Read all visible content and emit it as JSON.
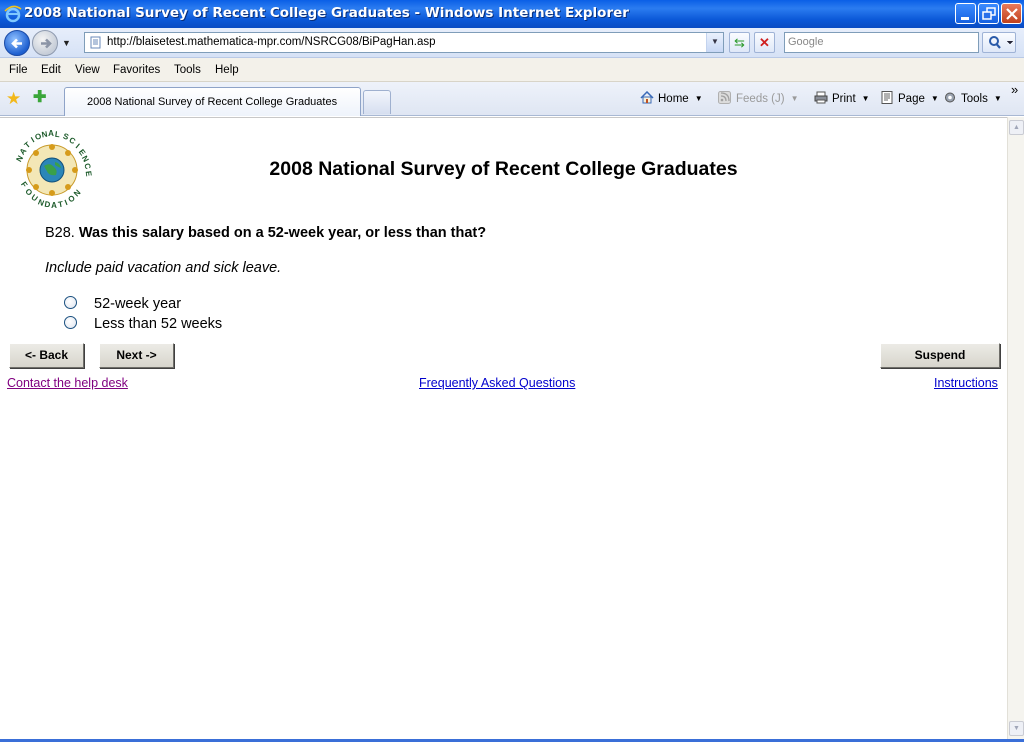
{
  "window": {
    "title": "2008 National Survey of Recent College Graduates - Windows Internet Explorer"
  },
  "browser": {
    "address": "http://blaisetest.mathematica-mpr.com/NSRCG08/BiPagHan.asp",
    "search_placeholder": "Google",
    "menu": [
      "File",
      "Edit",
      "View",
      "Favorites",
      "Tools",
      "Help"
    ],
    "tab_title": "2008 National Survey of Recent College Graduates",
    "commands": {
      "home": "Home",
      "feeds": "Feeds (J)",
      "print": "Print",
      "page": "Page",
      "tools": "Tools",
      "more": "»"
    }
  },
  "page": {
    "title": "2008 National Survey of Recent College Graduates",
    "logo_text": "NATIONAL SCIENCE FOUNDATION",
    "question": {
      "number": "B28.",
      "text": "Was this salary based on a 52-week year, or less than that?",
      "instruction": "Include paid vacation and sick leave.",
      "options": [
        "52-week year",
        "Less than 52 weeks"
      ]
    },
    "buttons": {
      "back": "<- Back",
      "next": "Next ->",
      "suspend": "Suspend"
    },
    "links": {
      "help_desk": "Contact the help desk",
      "faq": "Frequently Asked Questions",
      "instructions": "Instructions"
    }
  }
}
